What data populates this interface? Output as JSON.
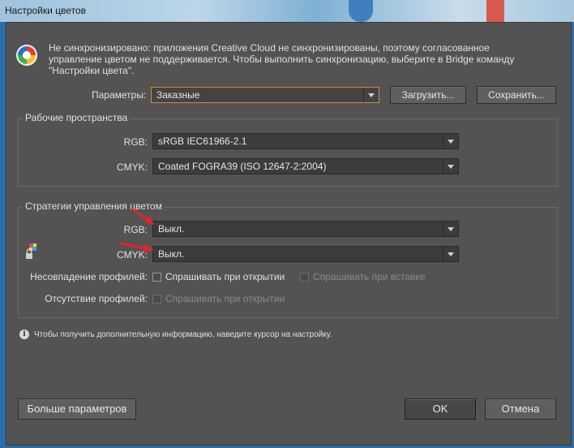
{
  "window": {
    "title": "Настройки цветов"
  },
  "sync": {
    "icon": "color-wheel-icon",
    "line1": "Не синхронизировано: приложения Creative Cloud не синхронизированы, поэтому согласованное",
    "line2": "управление цветом не поддерживается. Чтобы выполнить синхронизацию, выберите в Bridge команду",
    "line3": "\"Настройки цвета\"."
  },
  "settings": {
    "label": "Параметры:",
    "value": "Заказные",
    "load_label": "Загрузить...",
    "save_label": "Сохранить..."
  },
  "workspaces": {
    "title": "Рабочие пространства",
    "rgb_label": "RGB:",
    "rgb_value": "sRGB IEC61966-2.1",
    "cmyk_label": "CMYK:",
    "cmyk_value": "Coated FOGRA39 (ISO 12647-2:2004)"
  },
  "policies": {
    "title": "Стратегии управления цветом",
    "rgb_label": "RGB:",
    "rgb_value": "Выкл.",
    "cmyk_label": "CMYK:",
    "cmyk_value": "Выкл.",
    "mismatch_label": "Несовпадение профилей:",
    "ask_open_label": "Спрашивать при открытии",
    "ask_paste_label": "Спрашивать при вставке",
    "missing_label": "Отсутствие профилей:",
    "missing_ask_open_label": "Спрашивать при открытии"
  },
  "info": {
    "text": "Чтобы получить дополнительную информацию, наведите курсор на настройку."
  },
  "footer": {
    "more_label": "Больше параметров",
    "ok_label": "OK",
    "cancel_label": "Отмена"
  },
  "colors": {
    "accent": "#d88a2a",
    "annotation_arrow": "#e0262c",
    "dialog_bg": "#535353"
  }
}
